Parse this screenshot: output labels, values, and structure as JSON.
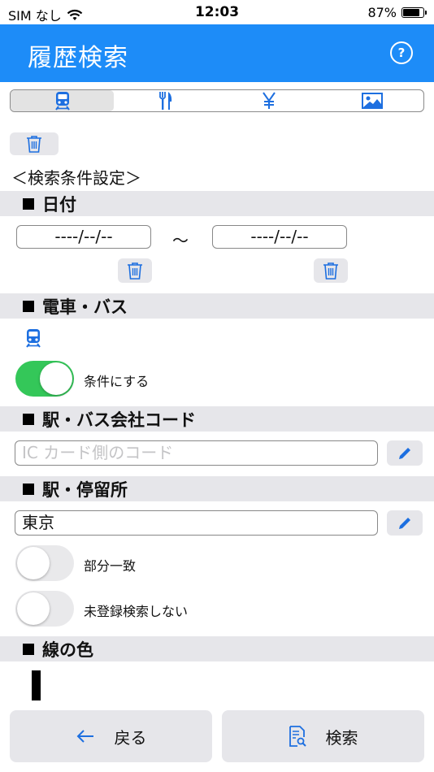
{
  "status_bar": {
    "carrier": "SIM なし",
    "time": "12:03",
    "battery": "87%",
    "battery_level": 0.87
  },
  "nav": {
    "title": "履歴検索",
    "help_icon": "question-circle-icon"
  },
  "segments": [
    {
      "icon": "train-icon",
      "active": true
    },
    {
      "icon": "fork-knife-icon",
      "active": false
    },
    {
      "icon": "yen-icon",
      "active": false
    },
    {
      "icon": "photo-icon",
      "active": false
    }
  ],
  "search_conditions_heading": "＜検索条件設定＞",
  "date_section": {
    "title": "日付",
    "from_value": "----/--/--",
    "separator": "〜",
    "to_value": "----/--/--"
  },
  "transport_section": {
    "title": "電車・バス",
    "toggle_label": "条件にする",
    "toggle_on": true
  },
  "company_code_section": {
    "title": "駅・バス会社コード",
    "placeholder": "IC カード側のコード",
    "value": ""
  },
  "station_section": {
    "title": "駅・停留所",
    "value": "東京",
    "partial_match_label": "部分一致",
    "partial_match_on": false,
    "exclude_unregistered_label": "未登録検索しない",
    "exclude_unregistered_on": false
  },
  "line_color_section": {
    "title": "線の色",
    "color": "#000000"
  },
  "buttons": {
    "back_label": "戻る",
    "search_label": "検索"
  },
  "colors": {
    "accent": "#1d8cf8",
    "toggle_on": "#34c759",
    "icon_blue": "#1d6fe0"
  }
}
